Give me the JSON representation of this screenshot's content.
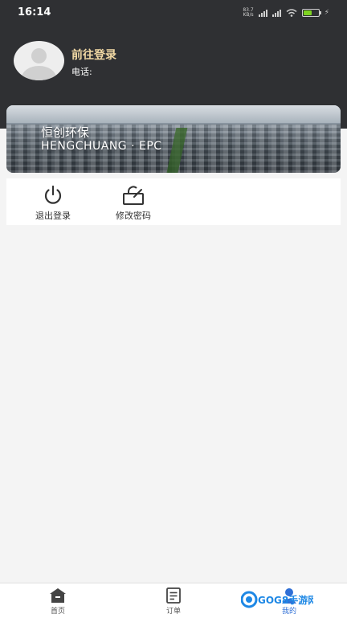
{
  "status_bar": {
    "time": "16:14",
    "net_speed": "83.7 KB/s",
    "battery_level": 0.55
  },
  "profile": {
    "login_link": "前往登录",
    "phone_label": "电话:"
  },
  "banner": {
    "title": "恒创环保",
    "subtitle": "HENGCHUANG · EPC"
  },
  "actions": [
    {
      "label": "退出登录",
      "icon": "power-icon"
    },
    {
      "label": "修改密码",
      "icon": "lock-edit-icon"
    }
  ],
  "tabbar": [
    {
      "label": "首页",
      "icon": "home-icon"
    },
    {
      "label": "订单",
      "icon": "order-list-icon"
    },
    {
      "label": "我的",
      "icon": "user-icon",
      "active": true
    }
  ],
  "watermark": {
    "text": "GOG8手游网",
    "color": "#1e88e5"
  },
  "colors": {
    "header_bg": "#2f3033",
    "login_accent": "#f2d9a4",
    "page_bg": "#f4f4f4",
    "active_tab": "#2f6fd6"
  }
}
